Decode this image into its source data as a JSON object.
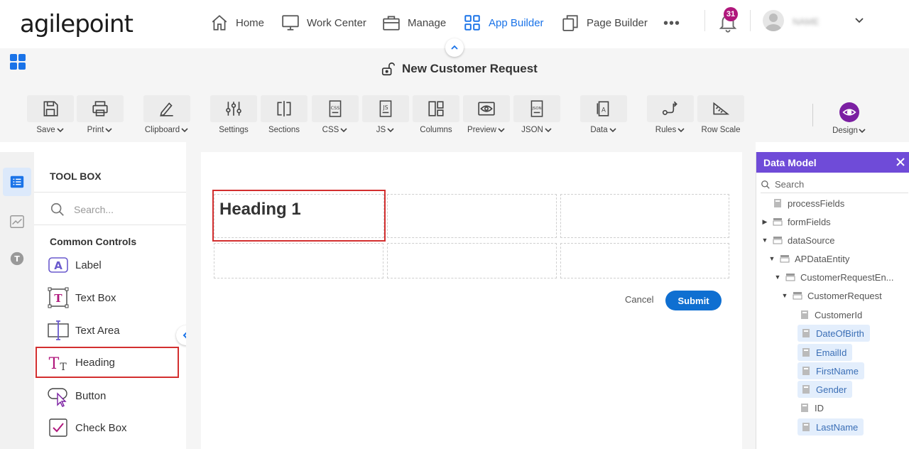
{
  "brand": {
    "logo_text": "agilepoint"
  },
  "nav": {
    "items": [
      {
        "label": "Home",
        "icon": "home-icon"
      },
      {
        "label": "Work Center",
        "icon": "monitor-icon"
      },
      {
        "label": "Manage",
        "icon": "briefcase-icon"
      },
      {
        "label": "App Builder",
        "icon": "grid-icon",
        "active": true
      },
      {
        "label": "Page Builder",
        "icon": "pages-icon"
      }
    ],
    "more": "•••",
    "notifications_count": "31",
    "username": "NAME"
  },
  "page": {
    "title": "New Customer Request"
  },
  "toolbar": {
    "save": "Save",
    "print": "Print",
    "clipboard": "Clipboard",
    "settings": "Settings",
    "sections": "Sections",
    "css": "CSS",
    "js": "JS",
    "columns": "Columns",
    "preview": "Preview",
    "json": "JSON",
    "data": "Data",
    "rules": "Rules",
    "row_scale": "Row Scale",
    "design": "Design"
  },
  "toolbox": {
    "title": "TOOL BOX",
    "search_placeholder": "Search...",
    "section": "Common Controls",
    "controls": [
      "Label",
      "Text Box",
      "Text Area",
      "Heading",
      "Button",
      "Check Box"
    ]
  },
  "canvas": {
    "heading_text": "Heading 1",
    "cancel_label": "Cancel",
    "submit_label": "Submit"
  },
  "data_model": {
    "title": "Data Model",
    "search_placeholder": "Search",
    "nodes": [
      {
        "label": "processFields"
      },
      {
        "label": "formFields"
      },
      {
        "label": "dataSource"
      },
      {
        "label": "APDataEntity"
      },
      {
        "label": "CustomerRequestEn..."
      },
      {
        "label": "CustomerRequest"
      },
      {
        "label": "CustomerId"
      },
      {
        "label": "DateOfBirth"
      },
      {
        "label": "EmailId"
      },
      {
        "label": "FirstName"
      },
      {
        "label": "Gender"
      },
      {
        "label": "ID"
      },
      {
        "label": "LastName"
      }
    ]
  },
  "colors": {
    "accent": "#1a73e8",
    "data_model_header": "#6f4bd8",
    "highlight_border": "#d32f2f",
    "submit": "#0f6fd1",
    "badge": "#b0177c"
  }
}
